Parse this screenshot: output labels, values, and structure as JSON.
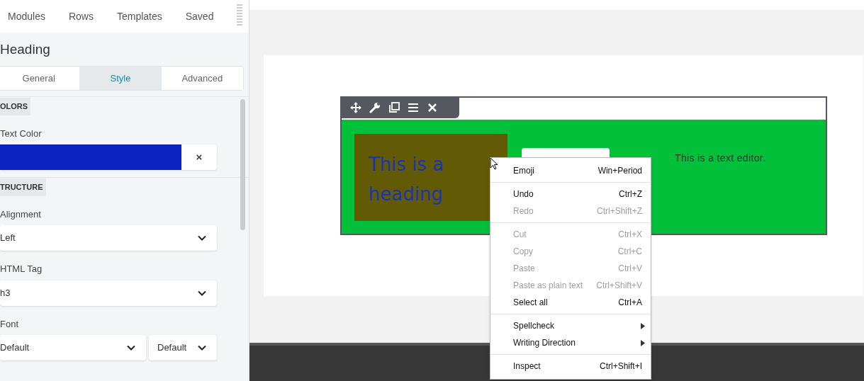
{
  "sidebar": {
    "top_tabs": [
      {
        "label": "Modules",
        "selected": false
      },
      {
        "label": "Rows",
        "selected": false
      },
      {
        "label": "Templates",
        "selected": false
      },
      {
        "label": "Saved",
        "selected": false
      }
    ],
    "title": "Heading",
    "tabs": [
      {
        "label": "General",
        "selected": false
      },
      {
        "label": "Style",
        "selected": true
      },
      {
        "label": "Advanced",
        "selected": false
      }
    ],
    "sections": [
      {
        "heading": "OLORS",
        "fields": [
          {
            "kind": "color",
            "label": "Text Color",
            "color": "#0c22bf",
            "clear": "×"
          }
        ]
      },
      {
        "heading": "TRUCTURE",
        "fields": [
          {
            "kind": "select",
            "label": "Alignment",
            "values": [
              "Left"
            ]
          },
          {
            "kind": "select",
            "label": "HTML Tag",
            "values": [
              "h3"
            ]
          },
          {
            "kind": "select",
            "label": "Font",
            "values": [
              "Default",
              "Default"
            ]
          }
        ]
      }
    ]
  },
  "canvas": {
    "heading": "This is a heading",
    "text": "This is a text editor."
  },
  "context_menu": {
    "groups": [
      [
        {
          "label": "Emoji",
          "shortcut": "Win+Period",
          "disabled": false,
          "submenu": false
        }
      ],
      [
        {
          "label": "Undo",
          "shortcut": "Ctrl+Z",
          "disabled": false,
          "submenu": false
        },
        {
          "label": "Redo",
          "shortcut": "Ctrl+Shift+Z",
          "disabled": true,
          "submenu": false
        }
      ],
      [
        {
          "label": "Cut",
          "shortcut": "Ctrl+X",
          "disabled": true,
          "submenu": false
        },
        {
          "label": "Copy",
          "shortcut": "Ctrl+C",
          "disabled": true,
          "submenu": false
        },
        {
          "label": "Paste",
          "shortcut": "Ctrl+V",
          "disabled": true,
          "submenu": false
        },
        {
          "label": "Paste as plain text",
          "shortcut": "Ctrl+Shift+V",
          "disabled": true,
          "submenu": false
        },
        {
          "label": "Select all",
          "shortcut": "Ctrl+A",
          "disabled": false,
          "submenu": false
        }
      ],
      [
        {
          "label": "Spellcheck",
          "disabled": false,
          "submenu": true
        },
        {
          "label": "Writing Direction",
          "disabled": false,
          "submenu": true
        }
      ],
      [
        {
          "label": "Inspect",
          "shortcut": "Ctrl+Shift+I",
          "disabled": false,
          "submenu": false
        }
      ]
    ]
  }
}
